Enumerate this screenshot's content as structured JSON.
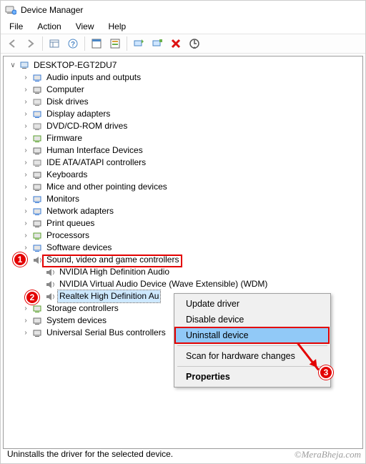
{
  "window": {
    "title": "Device Manager"
  },
  "menubar": {
    "file": "File",
    "action": "Action",
    "view": "View",
    "help": "Help"
  },
  "root": {
    "name": "DESKTOP-EGT2DU7"
  },
  "categories": [
    {
      "id": "audio-inputs",
      "label": "Audio inputs and outputs",
      "iconColor": "#3a7bd5"
    },
    {
      "id": "computer",
      "label": "Computer",
      "iconColor": "#6a6a6a"
    },
    {
      "id": "disk-drives",
      "label": "Disk drives",
      "iconColor": "#8a8a8a"
    },
    {
      "id": "display-adapters",
      "label": "Display adapters",
      "iconColor": "#3a7bd5"
    },
    {
      "id": "dvd-cd",
      "label": "DVD/CD-ROM drives",
      "iconColor": "#8a8a8a"
    },
    {
      "id": "firmware",
      "label": "Firmware",
      "iconColor": "#5aa02c"
    },
    {
      "id": "hid",
      "label": "Human Interface Devices",
      "iconColor": "#6a6a6a"
    },
    {
      "id": "ide",
      "label": "IDE ATA/ATAPI controllers",
      "iconColor": "#8a8a8a"
    },
    {
      "id": "keyboards",
      "label": "Keyboards",
      "iconColor": "#6a6a6a"
    },
    {
      "id": "mice",
      "label": "Mice and other pointing devices",
      "iconColor": "#6a6a6a"
    },
    {
      "id": "monitors",
      "label": "Monitors",
      "iconColor": "#3a7bd5"
    },
    {
      "id": "network",
      "label": "Network adapters",
      "iconColor": "#3a7bd5"
    },
    {
      "id": "ports",
      "label": "Print queues",
      "iconColor": "#6a6a6a"
    },
    {
      "id": "processors",
      "label": "Processors",
      "iconColor": "#5aa02c"
    },
    {
      "id": "software",
      "label": "Software devices",
      "iconColor": "#3a7bd5"
    }
  ],
  "sound_category": {
    "label": "Sound, video and game controllers"
  },
  "sound_children": [
    {
      "id": "nvidia-hda",
      "label": "NVIDIA High Definition Audio"
    },
    {
      "id": "nvidia-virtual",
      "label": "NVIDIA Virtual Audio Device (Wave Extensible) (WDM)"
    },
    {
      "id": "realtek",
      "label": "Realtek High Definition Au"
    }
  ],
  "after_categories": [
    {
      "id": "storage",
      "label": "Storage controllers",
      "iconColor": "#5aa02c"
    },
    {
      "id": "system",
      "label": "System devices",
      "iconColor": "#6a6a6a"
    },
    {
      "id": "usb",
      "label": "Universal Serial Bus controllers",
      "iconColor": "#6a6a6a"
    }
  ],
  "context_menu": {
    "update": "Update driver",
    "disable": "Disable device",
    "uninstall": "Uninstall device",
    "scan": "Scan for hardware changes",
    "properties": "Properties"
  },
  "status": "Uninstalls the driver for the selected device.",
  "badges": {
    "one": "1",
    "two": "2",
    "three": "3"
  },
  "watermark": "©MeraBheja.com"
}
